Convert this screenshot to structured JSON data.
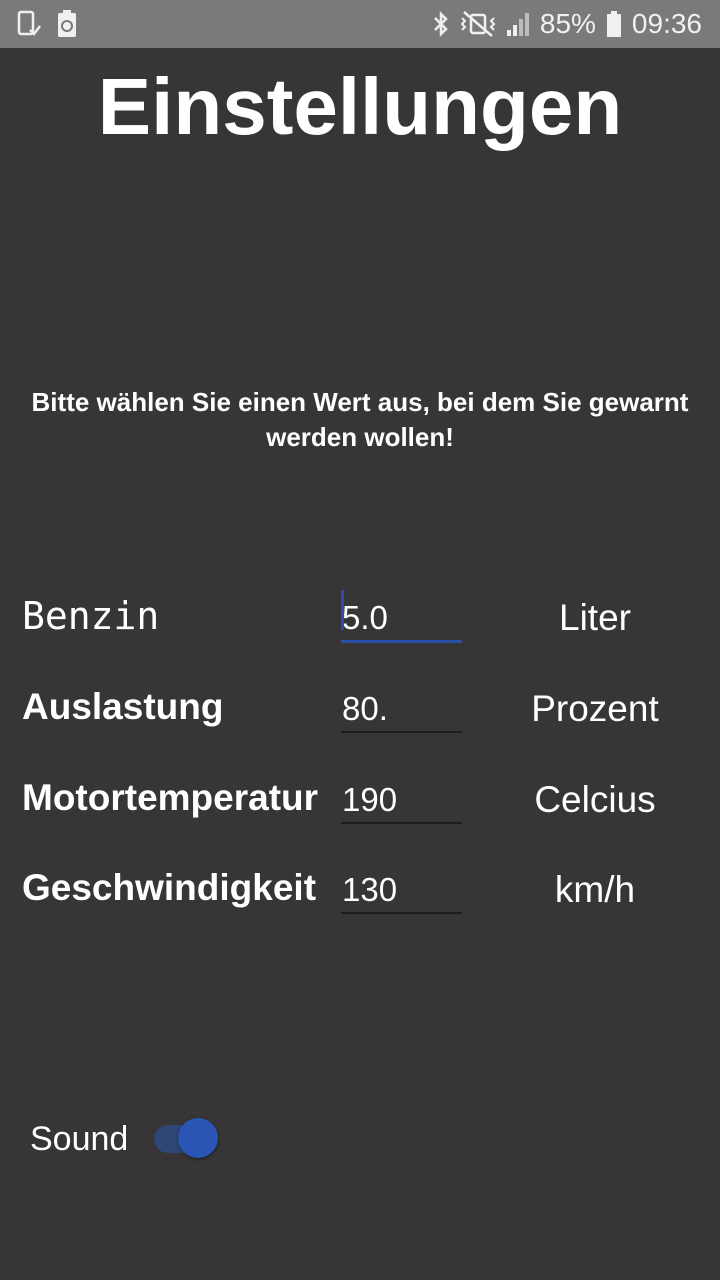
{
  "status_bar": {
    "battery_percent": "85%",
    "time": "09:36",
    "icons": [
      "screen-check-icon",
      "recycle-battery-icon",
      "bluetooth-icon",
      "vibrate-mute-icon",
      "signal-icon",
      "battery-icon"
    ]
  },
  "title": "Einstellungen",
  "instruction": "Bitte wählen Sie einen Wert aus, bei dem Sie gewarnt werden wollen!",
  "rows": [
    {
      "label": "Benzin",
      "value": "5.0",
      "unit": "Liter"
    },
    {
      "label": "Auslastung",
      "value": "80.",
      "unit": "Prozent"
    },
    {
      "label": "Motortemperatur",
      "value": "190",
      "unit": "Celcius"
    },
    {
      "label": "Geschwindigkeit",
      "value": "130",
      "unit": "km/h"
    }
  ],
  "sound": {
    "label": "Sound",
    "enabled": true
  },
  "colors": {
    "background": "#373536",
    "status_bar": "#7a7a7a",
    "accent": "#2a4fa8",
    "toggle_track": "#2f4677",
    "toggle_thumb": "#2a55b5"
  }
}
